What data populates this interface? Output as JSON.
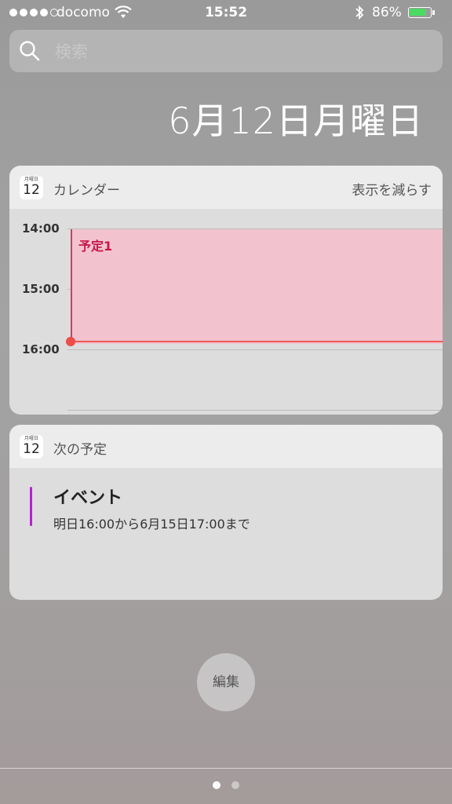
{
  "status_bar": {
    "signal_bars_filled": 4,
    "carrier": "docomo",
    "time": "15:52",
    "battery_percent": "86%",
    "battery_level": 0.86
  },
  "search": {
    "placeholder": "検索"
  },
  "date": "6月12日月曜日",
  "calendar_widget": {
    "icon_month_day": "月曜日",
    "icon_day": "12",
    "title": "カレンダー",
    "show_less": "表示を減らす",
    "hours": [
      "14:00",
      "15:00",
      "16:00"
    ],
    "event_title": "予定1"
  },
  "upcoming_widget": {
    "icon_month_day": "月曜日",
    "icon_day": "12",
    "title": "次の予定",
    "event_name": "イベント",
    "event_time": "明日16:00から6月15日17:00まで",
    "event_color": "#b721d2"
  },
  "edit_button": "編集",
  "pages": {
    "count": 2,
    "active": 0
  },
  "colors": {
    "event_fill": "#f2c3cf",
    "event_accent": "#e03561",
    "now_indicator": "#ec4d48",
    "battery": "#4cd964"
  }
}
